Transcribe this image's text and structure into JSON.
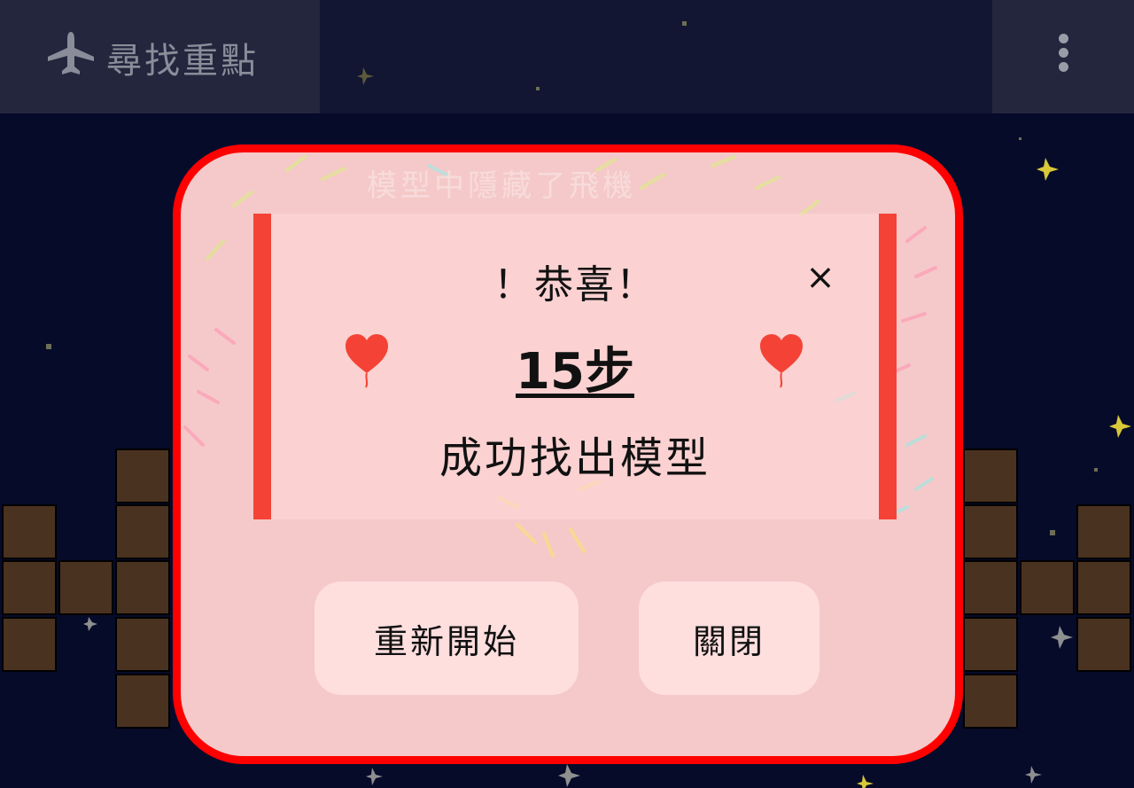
{
  "app": {
    "title": "尋找重點"
  },
  "icons": {
    "title": "airplane-icon",
    "menu": "more-vertical-icon",
    "close": "close-icon",
    "heart": "heart-balloon-icon"
  },
  "dialog": {
    "heading": "！恭喜！",
    "close_symbol": "×",
    "steps": "15步",
    "message": "成功找出模型",
    "faded_background_text": "模型中隱藏了飛機",
    "restart_label": "重新開始",
    "close_label": "關閉"
  },
  "colors": {
    "dialog_border": "#ff0000",
    "accent_bar": "#f44336",
    "background": "#070b2a",
    "block": "#4a3220"
  }
}
